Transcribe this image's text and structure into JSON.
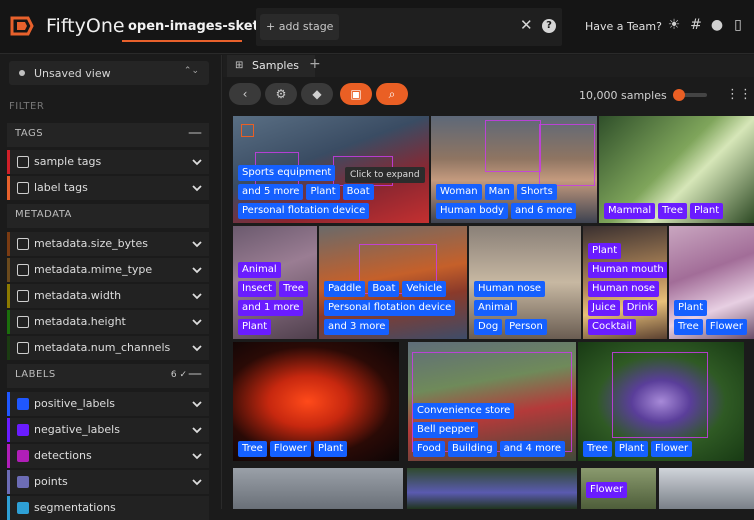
{
  "header": {
    "app_title": "FiftyOne",
    "dataset_name": "open-images-sketch",
    "add_stage": "+ add stage",
    "have_team": "Have a Team?",
    "icons": [
      "sun-icon",
      "slack-icon",
      "github-icon",
      "docs-icon"
    ]
  },
  "sidebar": {
    "view_label": "Unsaved view",
    "filter_label": "FILTER",
    "tags_section": "TAGS",
    "metadata_section": "METADATA",
    "labels_section": "LABELS",
    "labels_count": "6",
    "tags": [
      {
        "label": "sample tags",
        "color": "#d01f28"
      },
      {
        "label": "label tags",
        "color": "#e8612c"
      }
    ],
    "metadata": [
      {
        "label": "metadata.size_bytes",
        "color": "#7a3b12"
      },
      {
        "label": "metadata.mime_type",
        "color": "#6b4a1d"
      },
      {
        "label": "metadata.width",
        "color": "#8c7a00"
      },
      {
        "label": "metadata.height",
        "color": "#1b6f0c"
      },
      {
        "label": "metadata.num_channels",
        "color": "#1b3b12"
      }
    ],
    "labels": [
      {
        "label": "positive_labels",
        "color": "#1f57ff",
        "checked": true
      },
      {
        "label": "negative_labels",
        "color": "#6a1cff",
        "checked": true
      },
      {
        "label": "detections",
        "color": "#b01eb8",
        "checked": true
      },
      {
        "label": "points",
        "color": "#6c6cb5",
        "checked": true
      },
      {
        "label": "segmentations",
        "color": "#2ea0d6",
        "checked": true
      }
    ]
  },
  "main": {
    "tab_label": "Samples",
    "sample_count": "10,000 samples",
    "tooltip": "Click to expand",
    "tiles": [
      {
        "tags_pos": [
          "Plant",
          "Boat",
          "Sports equipment"
        ],
        "tags_pos2": [
          "Personal flotation device",
          "and 5 more"
        ],
        "tags_neg": []
      },
      {
        "tags_pos": [
          "Woman",
          "Man",
          "Shorts"
        ],
        "tags_pos2": [
          "Human body",
          "and 6 more"
        ],
        "tags_neg": []
      },
      {
        "tags_neg": [
          "Mammal",
          "Tree",
          "Plant"
        ]
      },
      {
        "tags_neg": [
          "Animal",
          "Insect",
          "Tree",
          "and 1 more",
          "Plant"
        ]
      },
      {
        "tags_pos": [
          "Paddle",
          "Boat",
          "Vehicle",
          "Personal flotation device",
          "and 3 more"
        ]
      },
      {
        "tags_pos": [
          "Human nose",
          "Person",
          "Animal",
          "Dog"
        ]
      },
      {
        "tags_neg": [
          "Plant",
          "Human mouth",
          "Human nose",
          "Juice",
          "Drink",
          "Cocktail"
        ]
      },
      {
        "tags_pos": [
          "Plant",
          "Flower",
          "Tree"
        ]
      },
      {
        "tags_pos": [
          "Tree",
          "Flower",
          "Plant"
        ]
      },
      {
        "tags_pos": [
          "Bell pepper",
          "Convenience store",
          "Food",
          "Building",
          "and 4 more"
        ]
      },
      {
        "tags_pos": [
          "Tree",
          "Plant",
          "Flower"
        ]
      },
      {
        "tags_neg": [
          "Flower"
        ]
      }
    ]
  }
}
